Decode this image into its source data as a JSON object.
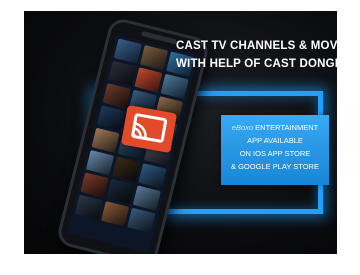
{
  "headline": {
    "line1": "CAST TV CHANNELS & MOVIES",
    "line2": "WITH HELP OF CAST DONGLE"
  },
  "info_box": {
    "brand": "eBoxo",
    "line1_rest": "ENTERTAINMENT",
    "line2": "APP AVAILABLE",
    "line3": "ON IOS APP STORE",
    "line4": "& GOOGLE PLAY STORE"
  },
  "icons": {
    "cast": "cast-icon"
  },
  "colors": {
    "accent_blue": "#1ea0ff",
    "cast_orange": "#e24a2a",
    "info_box": "#2596e6"
  }
}
